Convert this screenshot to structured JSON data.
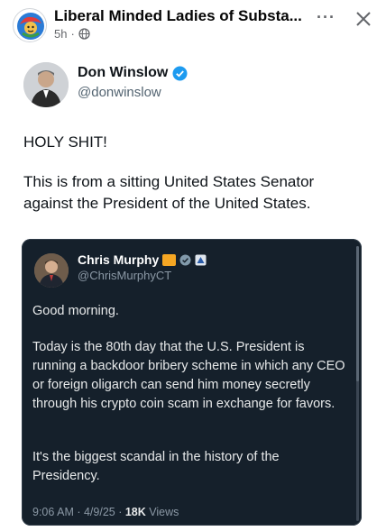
{
  "post": {
    "group_name": "Liberal Minded Ladies of Substa...",
    "time": "5h",
    "separator": "·",
    "more_label": "···"
  },
  "tweet": {
    "author_name": "Don Winslow",
    "author_handle": "@donwinslow",
    "text1": "HOLY SHIT!",
    "text2": "This is from a sitting United States Senator against the President of the United States."
  },
  "quote": {
    "author_name": "Chris Murphy",
    "author_handle": "@ChrisMurphyCT",
    "para1": "Good morning.",
    "para2": "Today is the 80th day that the U.S. President is running a backdoor bribery scheme in which any CEO or foreign oligarch can send him money secretly through his crypto coin scam in exchange for favors.",
    "para3": "It's the biggest scandal in the history of the Presidency.",
    "timestamp": "9:06 AM · 4/9/25 · ",
    "views_count": "18K",
    "views_label": " Views"
  },
  "icons": {
    "globe": "globe-icon",
    "more": "more-options-icon",
    "close": "close-icon",
    "verified": "verified-badge-icon"
  },
  "colors": {
    "verified_blue": "#1d9bf0",
    "card_bg": "#15202b",
    "meta_gray": "#65676b"
  }
}
